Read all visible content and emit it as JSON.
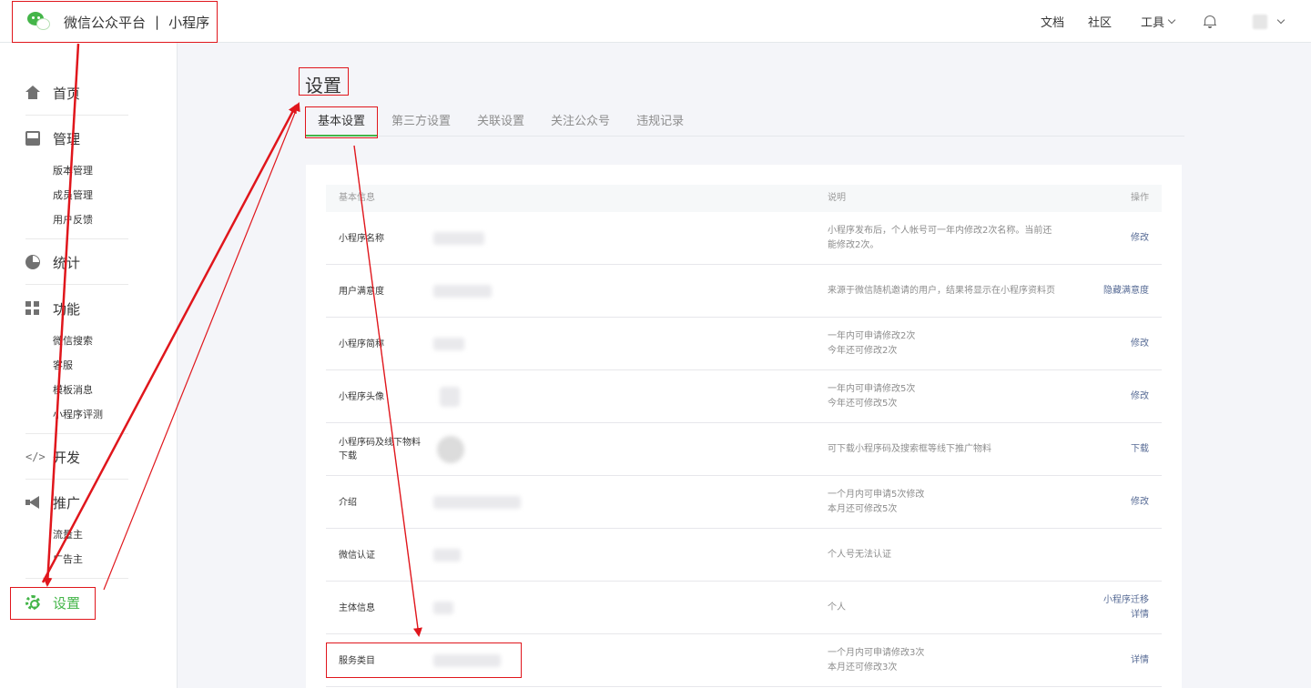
{
  "header": {
    "brand": "微信公众平台",
    "separator": "|",
    "product": "小程序",
    "nav": {
      "docs": "文档",
      "community": "社区",
      "tools": "工具"
    }
  },
  "sidebar": {
    "home": "首页",
    "manage": {
      "title": "管理",
      "items": [
        "版本管理",
        "成员管理",
        "用户反馈"
      ]
    },
    "stats": "统计",
    "features": {
      "title": "功能",
      "items": [
        "微信搜索",
        "客服",
        "模板消息",
        "小程序评测"
      ]
    },
    "develop": "开发",
    "promote": {
      "title": "推广",
      "items": [
        "流量主",
        "广告主"
      ]
    },
    "settings": "设置"
  },
  "main": {
    "title": "设置",
    "tabs": [
      "基本设置",
      "第三方设置",
      "关联设置",
      "关注公众号",
      "违规记录"
    ],
    "table": {
      "headers": {
        "info": "基本信息",
        "desc": "说明",
        "action": "操作"
      },
      "rows": [
        {
          "label": "小程序名称",
          "desc1": "小程序发布后，个人帐号可一年内修改2次名称。当前还",
          "desc2": "能修改2次。",
          "action": "修改",
          "action2": ""
        },
        {
          "label": "用户满意度",
          "desc1": "来源于微信随机邀请的用户，结果将显示在小程序资料页",
          "desc2": "",
          "action": "隐藏满意度",
          "action2": ""
        },
        {
          "label": "小程序简称",
          "desc1": "一年内可申请修改2次",
          "desc2": "今年还可修改2次",
          "action": "修改",
          "action2": ""
        },
        {
          "label": "小程序头像",
          "desc1": "一年内可申请修改5次",
          "desc2": "今年还可修改5次",
          "action": "修改",
          "action2": ""
        },
        {
          "label": "小程序码及线下物料下载",
          "desc1": "可下载小程序码及搜索框等线下推广物料",
          "desc2": "",
          "action": "下载",
          "action2": ""
        },
        {
          "label": "介绍",
          "desc1": "一个月内可申请5次修改",
          "desc2": "本月还可修改5次",
          "action": "修改",
          "action2": ""
        },
        {
          "label": "微信认证",
          "desc1": "个人号无法认证",
          "desc2": "",
          "action": "",
          "action2": ""
        },
        {
          "label": "主体信息",
          "desc1": "个人",
          "desc2": "",
          "action": "小程序迁移",
          "action2": "详情"
        },
        {
          "label": "服务类目",
          "desc1": "一个月内可申请修改3次",
          "desc2": "本月还可修改3次",
          "action": "详情",
          "action2": ""
        }
      ]
    }
  },
  "colors": {
    "accent": "#44b549",
    "link": "#576b95",
    "annotation": "#e0161c"
  }
}
